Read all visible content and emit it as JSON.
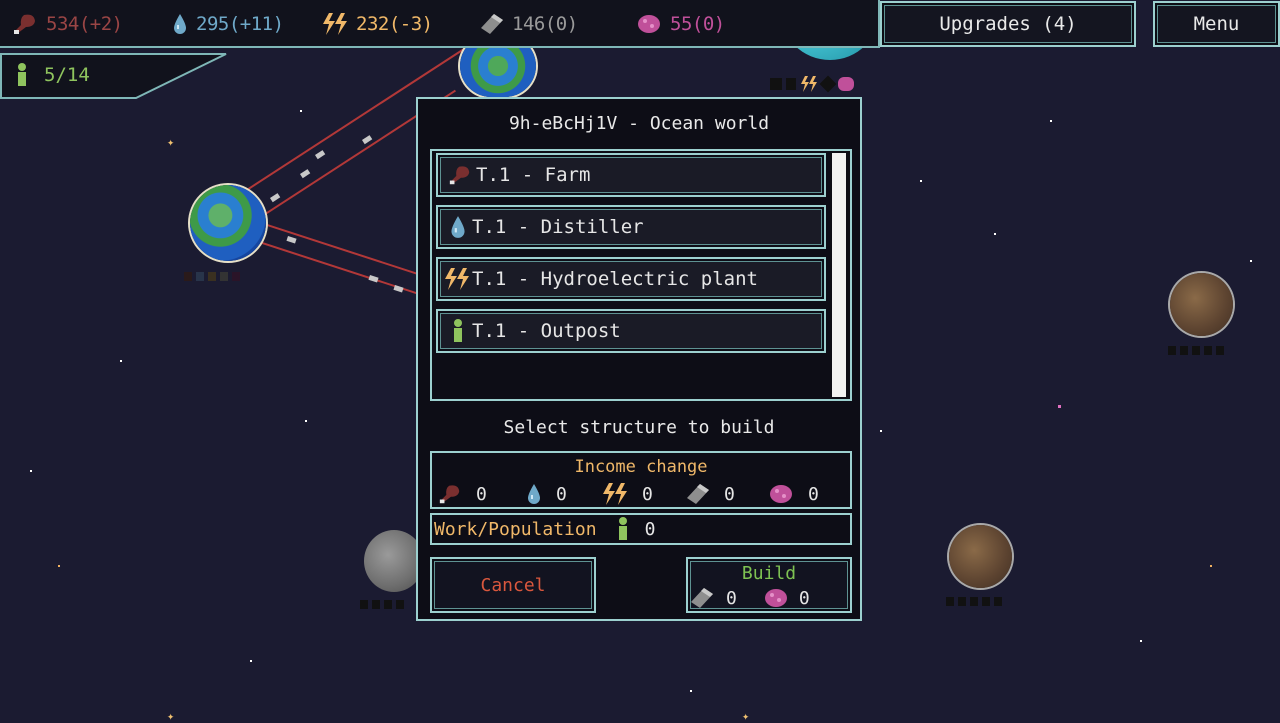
{
  "resources": [
    {
      "name": "food",
      "icon": "meat-icon",
      "value": "534(+2)",
      "color": "#9a4545"
    },
    {
      "name": "water",
      "icon": "water-drop-icon",
      "value": "295(+11)",
      "color": "#6fa9c9"
    },
    {
      "name": "energy",
      "icon": "lightning-icon",
      "value": "232(-3)",
      "color": "#f0b869"
    },
    {
      "name": "metal",
      "icon": "metal-ingot-icon",
      "value": "146(0)",
      "color": "#9a9a9a"
    },
    {
      "name": "bio",
      "icon": "bio-cell-icon",
      "value": "55(0)",
      "color": "#c0509a"
    }
  ],
  "population": {
    "icon": "person-icon",
    "value": "5/14",
    "color": "#8fc45e"
  },
  "top_buttons": {
    "upgrades": "Upgrades (4)",
    "menu": "Menu"
  },
  "dialog": {
    "title": "9h-eBcHj1V - Ocean world",
    "structures": [
      {
        "label": "T.1 - Farm",
        "icon": "meat-icon"
      },
      {
        "label": "T.1 - Distiller",
        "icon": "water-drop-icon"
      },
      {
        "label": "T.1 - Hydroelectric plant",
        "icon": "lightning-icon"
      },
      {
        "label": "T.1 - Outpost",
        "icon": "person-icon"
      }
    ],
    "select_label": "Select structure to build",
    "income_change": {
      "title": "Income change",
      "values": [
        "0",
        "0",
        "0",
        "0",
        "0"
      ]
    },
    "work_population": {
      "label": "Work/Population",
      "value": "0"
    },
    "cancel_label": "Cancel",
    "build": {
      "label": "Build",
      "metal_cost": "0",
      "bio_cost": "0"
    }
  },
  "colors": {
    "panel_border": "#9cd0cf",
    "cancel": "#d9573d",
    "build": "#7ec252",
    "income_title": "#f0b869",
    "space": "#1b1b31"
  }
}
